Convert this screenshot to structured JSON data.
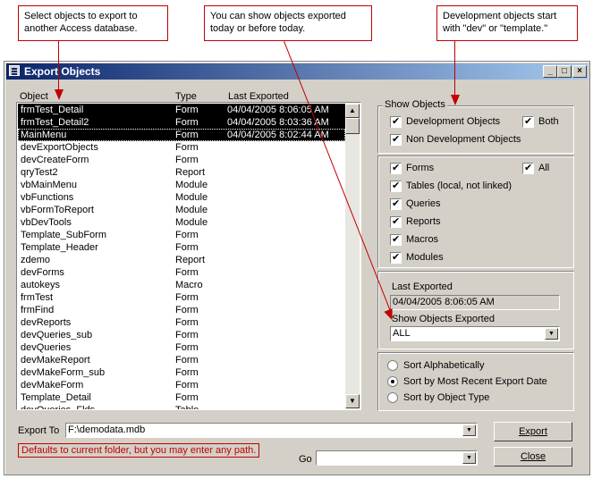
{
  "callouts": {
    "select": "Select objects to export to another Access database.",
    "show_exported": "You can show objects exported today or  before today.",
    "dev_objects": "Development objects start with \"dev\" or \"template.\""
  },
  "window": {
    "title": "Export Objects",
    "minimize": "_",
    "restore": "□",
    "close": "×"
  },
  "list": {
    "headers": {
      "object": "Object",
      "type": "Type",
      "last_exported": "Last Exported"
    },
    "rows": [
      {
        "object": "frmTest_Detail",
        "type": "Form",
        "last": "04/04/2005 8:06:05 AM",
        "selected": true
      },
      {
        "object": "frmTest_Detail2",
        "type": "Form",
        "last": "04/04/2005 8:03:36 AM",
        "selected": true
      },
      {
        "object": "MainMenu",
        "type": "Form",
        "last": "04/04/2005 8:02:44 AM",
        "selected": true
      },
      {
        "object": "devExportObjects",
        "type": "Form",
        "last": ""
      },
      {
        "object": "devCreateForm",
        "type": "Form",
        "last": ""
      },
      {
        "object": "qryTest2",
        "type": "Report",
        "last": ""
      },
      {
        "object": "vbMainMenu",
        "type": "Module",
        "last": ""
      },
      {
        "object": "vbFunctions",
        "type": "Module",
        "last": ""
      },
      {
        "object": "vbFormToReport",
        "type": "Module",
        "last": ""
      },
      {
        "object": "vbDevTools",
        "type": "Module",
        "last": ""
      },
      {
        "object": "Template_SubForm",
        "type": "Form",
        "last": ""
      },
      {
        "object": "Template_Header",
        "type": "Form",
        "last": ""
      },
      {
        "object": "zdemo",
        "type": "Report",
        "last": ""
      },
      {
        "object": "devForms",
        "type": "Form",
        "last": ""
      },
      {
        "object": "autokeys",
        "type": "Macro",
        "last": ""
      },
      {
        "object": "frmTest",
        "type": "Form",
        "last": ""
      },
      {
        "object": "frmFind",
        "type": "Form",
        "last": ""
      },
      {
        "object": "devReports",
        "type": "Form",
        "last": ""
      },
      {
        "object": "devQueries_sub",
        "type": "Form",
        "last": ""
      },
      {
        "object": "devQueries",
        "type": "Form",
        "last": ""
      },
      {
        "object": "devMakeReport",
        "type": "Form",
        "last": ""
      },
      {
        "object": "devMakeForm_sub",
        "type": "Form",
        "last": ""
      },
      {
        "object": "devMakeForm",
        "type": "Form",
        "last": ""
      },
      {
        "object": "Template_Detail",
        "type": "Form",
        "last": ""
      },
      {
        "object": "devQueries_Flds",
        "type": "Table",
        "last": ""
      }
    ]
  },
  "show_objects": {
    "label": "Show Objects",
    "dev": "Development Objects",
    "both": "Both",
    "nondev": "Non Development Objects"
  },
  "types": {
    "forms": "Forms",
    "all": "All",
    "tables": "Tables (local, not linked)",
    "queries": "Queries",
    "reports": "Reports",
    "macros": "Macros",
    "modules": "Modules"
  },
  "last_exported": {
    "label": "Last Exported",
    "value": "04/04/2005 8:06:05 AM",
    "show_label": "Show Objects Exported",
    "show_value": "ALL"
  },
  "sort": {
    "alpha": "Sort Alphabetically",
    "recent": "Sort by Most Recent Export Date",
    "type": "Sort by Object Type"
  },
  "export_to": {
    "label": "Export To",
    "value": "F:\\demodata.mdb",
    "hint": "Defaults to current folder, but you may enter any path."
  },
  "go": {
    "label": "Go",
    "value": ""
  },
  "buttons": {
    "export": "Export",
    "close": "Close"
  },
  "colors": {
    "accent": "#c00000",
    "titlebar": "#0a246a",
    "face": "#d4d0c8"
  }
}
